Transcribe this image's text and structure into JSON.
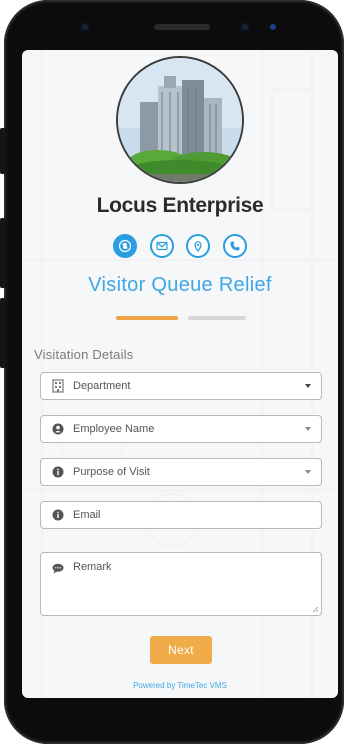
{
  "company": {
    "name": "Locus Enterprise"
  },
  "contact_icons": [
    "globe-icon",
    "mail-icon",
    "location-pin-icon",
    "phone-icon"
  ],
  "page": {
    "title": "Visitor Queue Relief",
    "section_label": "Visitation Details",
    "current_step": 1,
    "total_steps": 2
  },
  "form": {
    "department": {
      "placeholder": "Department",
      "icon": "building-icon"
    },
    "employee": {
      "placeholder": "Employee Name",
      "icon": "user-icon"
    },
    "purpose": {
      "placeholder": "Purpose of Visit",
      "icon": "info-icon"
    },
    "email": {
      "placeholder": "Email",
      "icon": "info-icon"
    },
    "remark": {
      "placeholder": "Remark",
      "icon": "comment-icon"
    }
  },
  "actions": {
    "next_label": "Next"
  },
  "footer": {
    "powered_by": "Powered by TimeTec VMS"
  },
  "colors": {
    "accent_blue": "#3fa7e4",
    "icon_blue": "#2a9ee0",
    "accent_orange": "#efa443",
    "inactive_step": "#d7d7d7"
  }
}
